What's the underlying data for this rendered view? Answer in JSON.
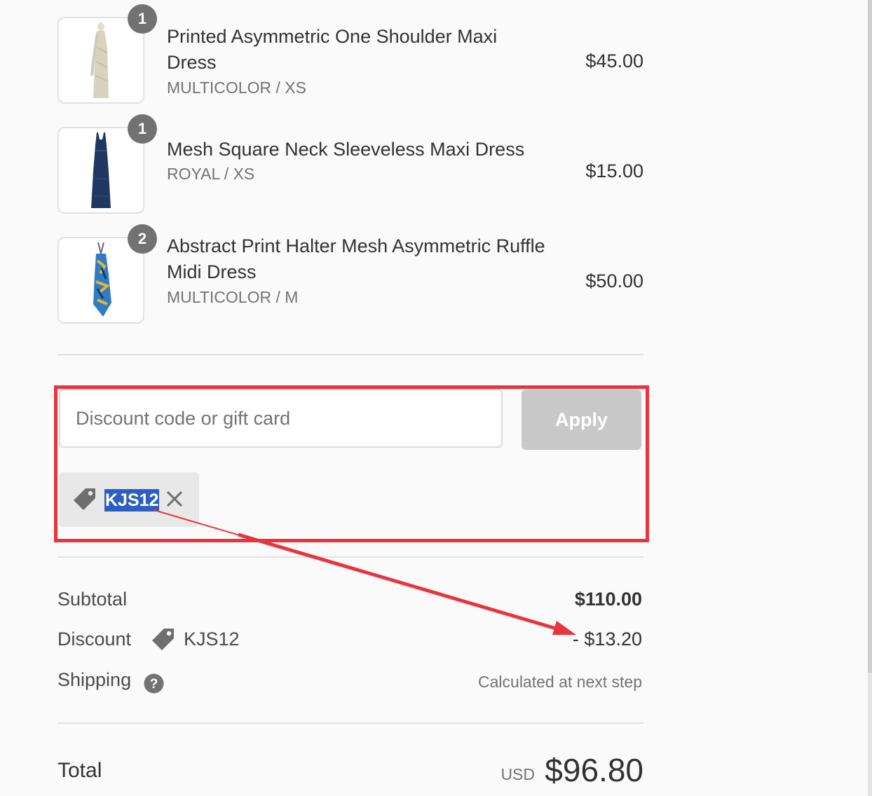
{
  "items": [
    {
      "qty": "1",
      "name": "Printed Asymmetric One Shoulder Maxi Dress",
      "variant": "MULTICOLOR / XS",
      "price": "$45.00",
      "image_icon": "beige-dress-thumbnail"
    },
    {
      "qty": "1",
      "name": "Mesh Square Neck Sleeveless Maxi Dress",
      "variant": "ROYAL / XS",
      "price": "$15.00",
      "image_icon": "navy-dress-thumbnail"
    },
    {
      "qty": "2",
      "name": "Abstract Print Halter Mesh Asymmetric Ruffle Midi Dress",
      "variant": "MULTICOLOR / M",
      "price": "$50.00",
      "image_icon": "blue-print-dress-thumbnail"
    }
  ],
  "discount": {
    "placeholder": "Discount code or gift card",
    "apply_label": "Apply",
    "applied_code": "KJS12"
  },
  "summary": {
    "subtotal_label": "Subtotal",
    "subtotal_value": "$110.00",
    "discount_label": "Discount",
    "discount_code": "KJS12",
    "discount_value": "- $13.20",
    "shipping_label": "Shipping",
    "shipping_value": "Calculated at next step",
    "total_label": "Total",
    "currency": "USD",
    "total_value": "$96.80"
  },
  "colors": {
    "annotation": "#e8343c",
    "selection": "#2b5fc4",
    "apply_disabled": "#c8c8c8"
  }
}
